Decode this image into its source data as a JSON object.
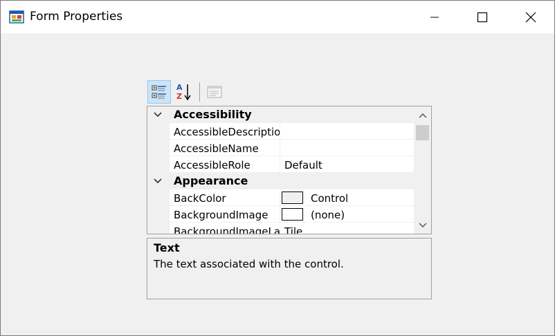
{
  "window": {
    "title": "Form Properties",
    "icon": "winforms-app-icon",
    "controls": [
      "minimize",
      "maximize",
      "close"
    ]
  },
  "toolbar": {
    "buttons": [
      {
        "name": "categorized",
        "icon": "categorized-icon",
        "active": true
      },
      {
        "name": "alphabetical",
        "icon": "sort-az-icon",
        "active": false
      },
      {
        "name": "property-pages",
        "icon": "property-pages-icon",
        "active": false,
        "enabled": false
      }
    ]
  },
  "grid": {
    "categories": [
      {
        "label": "Accessibility",
        "expanded": true,
        "properties": [
          {
            "name": "AccessibleDescriptior",
            "value": ""
          },
          {
            "name": "AccessibleName",
            "value": ""
          },
          {
            "name": "AccessibleRole",
            "value": "Default"
          }
        ]
      },
      {
        "label": "Appearance",
        "expanded": true,
        "properties": [
          {
            "name": "BackColor",
            "value": "Control",
            "swatch": "#f0f0f0"
          },
          {
            "name": "BackgroundImage",
            "value": "(none)",
            "swatch": "#ffffff"
          },
          {
            "name": "BackgroundImageLa",
            "value": "Tile"
          }
        ]
      }
    ]
  },
  "description": {
    "title": "Text",
    "text": "The text associated with the control."
  },
  "colors": {
    "background": "#f0f0f0",
    "selected_button": "#cce4f7",
    "border": "#a0a0a0"
  }
}
